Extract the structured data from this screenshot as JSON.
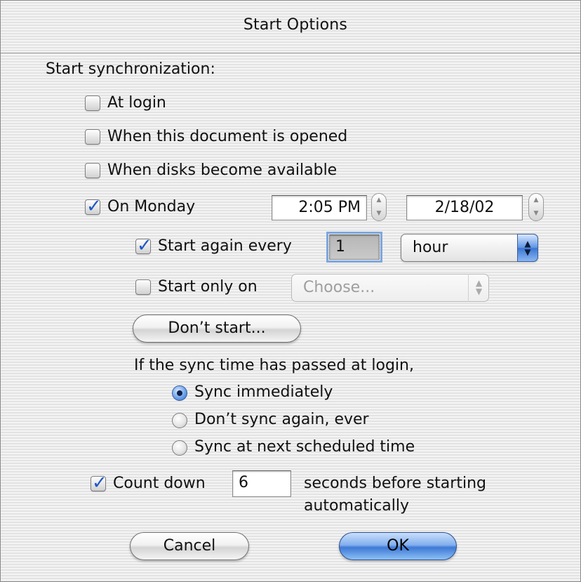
{
  "window": {
    "title": "Start Options"
  },
  "section": {
    "label": "Start synchronization:"
  },
  "options": {
    "at_login": {
      "label": "At login",
      "checked": false
    },
    "doc_opened": {
      "label": "When this document is opened",
      "checked": false
    },
    "disks_available": {
      "label": "When disks become available",
      "checked": false
    },
    "on_day": {
      "label": "On Monday",
      "checked": true,
      "time": "2:05 PM",
      "date": "2/18/02"
    }
  },
  "repeat": {
    "start_again": {
      "label": "Start again every",
      "checked": true,
      "value": "1",
      "unit": "hour"
    },
    "start_only": {
      "label": "Start only on",
      "checked": false,
      "placeholder": "Choose..."
    },
    "dont_start_label": "Don’t start..."
  },
  "missed": {
    "prompt": "If the sync time has passed at login,",
    "choices": [
      {
        "label": "Sync immediately",
        "selected": true
      },
      {
        "label": "Don’t sync again, ever",
        "selected": false
      },
      {
        "label": "Sync at next scheduled time",
        "selected": false
      }
    ]
  },
  "countdown": {
    "label": "Count down",
    "checked": true,
    "value": "6",
    "suffix_line1": "seconds before starting",
    "suffix_line2": "automatically"
  },
  "buttons": {
    "cancel": "Cancel",
    "ok": "OK"
  },
  "colors": {
    "accent": "#3e79d6",
    "checkmark": "#1f57c8"
  },
  "icons": {
    "checkmark": "check-icon",
    "stepper": "stepper-arrows-icon",
    "popup": "popup-arrows-icon"
  }
}
